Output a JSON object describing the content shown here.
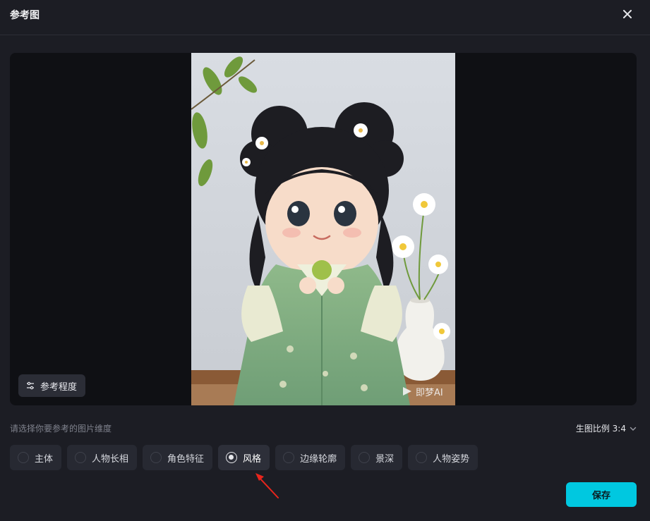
{
  "dialog": {
    "title": "参考图"
  },
  "preview": {
    "reference_button": "参考程度",
    "watermark": "即梦AI"
  },
  "dimensions": {
    "hint": "请选择你要参考的图片维度",
    "ratio_label": "生图比例 3:4",
    "options": [
      {
        "label": "主体",
        "selected": false
      },
      {
        "label": "人物长相",
        "selected": false
      },
      {
        "label": "角色特征",
        "selected": false
      },
      {
        "label": "风格",
        "selected": true
      },
      {
        "label": "边缘轮廓",
        "selected": false
      },
      {
        "label": "景深",
        "selected": false
      },
      {
        "label": "人物姿势",
        "selected": false
      }
    ]
  },
  "footer": {
    "save_label": "保存"
  },
  "colors": {
    "accent": "#00c8e0",
    "annotation_arrow": "#e8251c",
    "background": "#1c1d24"
  },
  "icons": {
    "close": "close-icon",
    "sliders": "sliders-icon",
    "chevron": "chevron-down-icon"
  }
}
